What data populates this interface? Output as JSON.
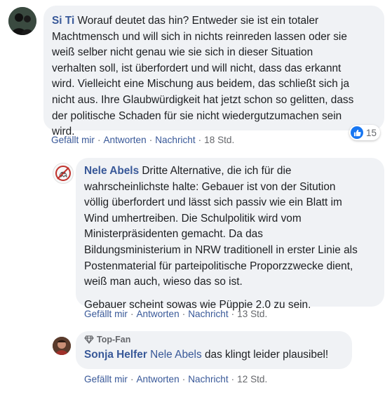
{
  "comments": [
    {
      "author": "Si Ti",
      "text_lines": [
        " Worauf deutet das hin? Entweder sie ist ein totaler",
        "Machtmensch und will sich in nichts reinreden lassen oder sie",
        "weiß selber nicht genau wie sie sich in dieser Situation",
        "verhalten soll, ist überfordert und will nicht, dass das erkannt",
        "wird. Vielleicht eine Mischung aus beidem, das schließt sich ja",
        "nicht aus. Ihre Glaubwürdigkeit hat jetzt schon so gelitten, dass",
        "der politische Schaden für sie nicht wiedergutzumachen sein",
        "wird."
      ],
      "reaction_count": "15",
      "actions": {
        "like": "Gefällt mir",
        "reply": "Antworten",
        "message": "Nachricht",
        "time": "18 Std."
      }
    },
    {
      "author": "Nele Abels",
      "text_lines": [
        " Dritte Alternative, die ich für die",
        "wahrscheinlichste halte: Gebauer ist von der Sitution",
        "völlig überfordert und lässt sich passiv wie ein Blatt im",
        "Wind umhertreiben. Die Schulpolitik wird vom",
        "Ministerpräsidenten gemacht. Da das",
        "Bildungsministerium in NRW traditionell in erster Linie als",
        "Postenmaterial für parteipolitische Proporzzwecke dient,",
        "weiß man auch, wieso das so ist."
      ],
      "paragraph2": "Gebauer scheint sowas wie Püppie 2.0 zu sein.",
      "actions": {
        "like": "Gefällt mir",
        "reply": "Antworten",
        "message": "Nachricht",
        "time": "13 Std."
      }
    },
    {
      "badge": "Top-Fan",
      "author": "Sonja Helfer",
      "mention": "Nele Abels",
      "text": " das klingt leider plausibel!",
      "actions": {
        "like": "Gefällt mir",
        "reply": "Antworten",
        "message": "Nachricht",
        "time": "12 Std."
      }
    }
  ],
  "colors": {
    "link": "#385898",
    "bubble": "#f0f2f5",
    "meta": "#65676b",
    "like": "#1877f2"
  }
}
